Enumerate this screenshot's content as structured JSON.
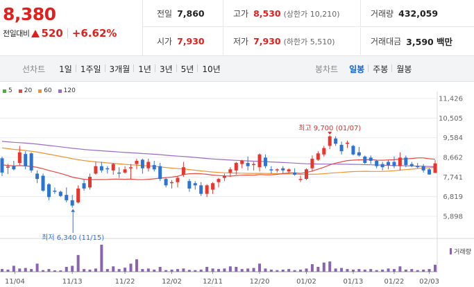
{
  "quote": {
    "price": "8,380",
    "change_label": "전일대비",
    "change_amount": "520",
    "change_rate": "+6.62%",
    "prev_close_label": "전일",
    "prev_close": "7,860",
    "high_label": "고가",
    "high": "8,530",
    "upper_limit": "(상한가 10,210)",
    "volume_label": "거래량",
    "volume": "432,059",
    "open_label": "시가",
    "open": "7,930",
    "low_label": "저가",
    "low": "7,930",
    "lower_limit": "(하한가 5,510)",
    "value_label": "거래대금",
    "value": "3,590 백만",
    "up_color": "#e0201d"
  },
  "toolbar": {
    "line_chart_label": "선차트",
    "periods": [
      "1일",
      "1주일",
      "3개월",
      "1년",
      "3년",
      "5년",
      "10년"
    ],
    "candle_chart_label": "봉차트",
    "candle_periods": [
      "일봉",
      "주봉",
      "월봉"
    ],
    "active_candle_period": "일봉"
  },
  "chart_data": {
    "type": "candlestick",
    "ma_legend": [
      {
        "name": "5",
        "color": "#4caf3a"
      },
      {
        "name": "20",
        "color": "#e8483f"
      },
      {
        "name": "60",
        "color": "#f0922c"
      },
      {
        "name": "120",
        "color": "#9b6bc6"
      }
    ],
    "y_ticks": [
      "11,426",
      "10,505",
      "9,584",
      "8,662",
      "7,741",
      "6,819",
      "5,898"
    ],
    "ylim": [
      5898,
      11426
    ],
    "x_ticks": [
      "11/04",
      "11/13",
      "11/22",
      "12/02",
      "12/11",
      "12/20",
      "01/02",
      "01/13",
      "01/22",
      "02/03"
    ],
    "high_annotation": "최고 9,700 (01/07)",
    "low_annotation": "최저 6,340 (11/15)",
    "volume_label": "거래량",
    "candles": [
      [
        8620,
        8700,
        7780,
        7950
      ],
      [
        8180,
        8350,
        7880,
        8230
      ],
      [
        8250,
        8500,
        8050,
        8100
      ],
      [
        8400,
        9200,
        8300,
        8900
      ],
      [
        8820,
        8950,
        8100,
        8250
      ],
      [
        8850,
        8900,
        7950,
        8050
      ],
      [
        7900,
        8050,
        7450,
        7650
      ],
      [
        7800,
        7900,
        7050,
        7100
      ],
      [
        7400,
        7450,
        6650,
        6800
      ],
      [
        7100,
        7250,
        6950,
        7050
      ],
      [
        7050,
        7100,
        6800,
        6850
      ],
      [
        6900,
        7250,
        6550,
        6650
      ],
      [
        6650,
        6900,
        6300,
        6400
      ],
      [
        6550,
        7350,
        6500,
        7200
      ],
      [
        7450,
        7650,
        7100,
        7200
      ],
      [
        7250,
        7900,
        7150,
        7750
      ],
      [
        7900,
        8450,
        7850,
        8250
      ],
      [
        8250,
        8450,
        7950,
        8050
      ],
      [
        8150,
        8250,
        7900,
        8100
      ],
      [
        8050,
        8400,
        7850,
        8350
      ],
      [
        7950,
        8200,
        7700,
        7900
      ],
      [
        7950,
        8250,
        7900,
        8100
      ],
      [
        8150,
        8350,
        7650,
        8200
      ],
      [
        8350,
        8600,
        8100,
        8500
      ],
      [
        8550,
        8600,
        7900,
        8150
      ],
      [
        8150,
        8600,
        8000,
        8450
      ],
      [
        8300,
        8500,
        8000,
        8100
      ],
      [
        8250,
        8400,
        7550,
        7650
      ],
      [
        7650,
        7700,
        7250,
        7350
      ],
      [
        7450,
        7600,
        7200,
        7500
      ],
      [
        7500,
        7800,
        7250,
        7700
      ],
      [
        7850,
        8450,
        7750,
        8200
      ],
      [
        7550,
        7650,
        7050,
        7200
      ],
      [
        7450,
        7550,
        7150,
        7350
      ],
      [
        7350,
        7500,
        6850,
        6950
      ],
      [
        6950,
        7400,
        6800,
        7350
      ],
      [
        7150,
        7500,
        6950,
        7450
      ],
      [
        7500,
        7700,
        7250,
        7650
      ],
      [
        7700,
        7900,
        7550,
        7800
      ],
      [
        7950,
        8200,
        7750,
        8100
      ],
      [
        8050,
        8450,
        7850,
        8400
      ],
      [
        8350,
        8550,
        8150,
        8500
      ],
      [
        8400,
        8700,
        8050,
        8250
      ],
      [
        8300,
        8450,
        8050,
        8350
      ],
      [
        8200,
        8850,
        8000,
        8800
      ],
      [
        8650,
        8800,
        8150,
        8250
      ],
      [
        8100,
        8250,
        7900,
        8050
      ],
      [
        8050,
        8150,
        7950,
        8100
      ],
      [
        8150,
        8250,
        7900,
        8050
      ],
      [
        8000,
        8150,
        7900,
        8100
      ],
      [
        7950,
        8150,
        7800,
        7850
      ],
      [
        7600,
        7800,
        7500,
        7650
      ],
      [
        7650,
        8150,
        7600,
        8100
      ],
      [
        8150,
        8750,
        8000,
        8600
      ],
      [
        8550,
        8950,
        8500,
        8850
      ],
      [
        8800,
        9200,
        8700,
        9100
      ],
      [
        9200,
        9700,
        9050,
        9650
      ],
      [
        9550,
        9650,
        9200,
        9300
      ],
      [
        9250,
        9400,
        8800,
        8950
      ],
      [
        9300,
        9450,
        9100,
        9350
      ],
      [
        9200,
        9250,
        8750,
        8800
      ],
      [
        8900,
        9150,
        8700,
        8750
      ],
      [
        8700,
        8750,
        8350,
        8400
      ],
      [
        8650,
        8750,
        8350,
        8500
      ],
      [
        8500,
        8550,
        8150,
        8250
      ],
      [
        8350,
        8450,
        8050,
        8200
      ],
      [
        8450,
        8550,
        8100,
        8300
      ],
      [
        8450,
        8700,
        8150,
        8250
      ],
      [
        8250,
        8900,
        8050,
        8650
      ],
      [
        8650,
        8750,
        8200,
        8300
      ],
      [
        8350,
        8450,
        8200,
        8250
      ],
      [
        8250,
        8400,
        8150,
        8200
      ],
      [
        8250,
        8350,
        7950,
        8050
      ],
      [
        8100,
        8150,
        7850,
        7860
      ],
      [
        7930,
        8530,
        7930,
        8380
      ]
    ],
    "volumes": [
      0.1,
      0.08,
      0.22,
      0.12,
      0.14,
      0.1,
      0.3,
      0.06,
      0.1,
      0.05,
      0.05,
      0.18,
      0.22,
      0.62,
      0.1,
      0.08,
      0.12,
      1.0,
      0.1,
      0.2,
      0.1,
      0.15,
      0.3,
      0.46,
      0.1,
      0.12,
      0.08,
      0.18,
      0.06,
      0.08,
      0.1,
      0.12,
      0.07,
      0.06,
      0.08,
      0.18,
      0.12,
      0.1,
      0.12,
      0.2,
      0.18,
      0.1,
      0.12,
      0.14,
      0.3,
      0.12,
      0.08,
      0.06,
      0.08,
      0.1,
      0.06,
      0.08,
      0.12,
      0.28,
      0.18,
      0.34,
      0.38,
      0.12,
      0.14,
      0.1,
      0.08,
      0.1,
      0.08,
      0.1,
      0.06,
      0.08,
      0.12,
      0.1,
      0.2,
      0.08,
      0.1,
      0.06,
      0.08,
      0.1,
      0.26
    ]
  }
}
